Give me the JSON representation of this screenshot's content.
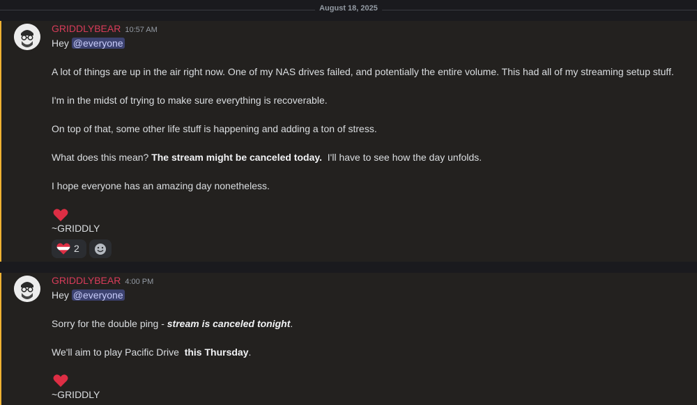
{
  "date_divider": "August 18, 2025",
  "messages": [
    {
      "author": "GRIDDLYBEAR",
      "time": "10:57 AM",
      "greeting": "Hey",
      "mention": "@everyone",
      "p1": "A lot of things are up in the air right now. One of my NAS drives failed, and potentially the entire volume. This had all of my streaming setup stuff.",
      "p2": "I'm in the midst of trying to make sure everything is recoverable.",
      "p3": "On top of that, some other life stuff is happening and adding a ton of stress.",
      "p4_pre": "What does this mean?",
      "p4_bold": "The stream might be canceled today.",
      "p4_post": "I'll have to see how the day unfolds.",
      "p5": "I hope everyone has an amazing day nonetheless.",
      "heart_icon": "red-heart-icon",
      "signoff": "~GRIDDLY",
      "reactions": [
        {
          "icon": "striped-heart-icon",
          "count": "2"
        },
        {
          "icon": "add-reaction-icon"
        }
      ]
    },
    {
      "author": "GRIDDLYBEAR",
      "time": "4:00 PM",
      "greeting": "Hey",
      "mention": "@everyone",
      "p1_pre": "Sorry for the double ping -",
      "p1_bolditalic": "stream is canceled tonight",
      "p1_post": ".",
      "p2_pre": "We'll aim to play Pacific Drive",
      "p2_bold": "this Thursday",
      "p2_post": ".",
      "heart_icon": "red-heart-icon",
      "signoff": "~GRIDDLY"
    }
  ],
  "colors": {
    "username": "#d83c5a",
    "mention_bg": "#3c4270",
    "highlight_border": "#f0b232",
    "message_bg": "#23211f"
  }
}
